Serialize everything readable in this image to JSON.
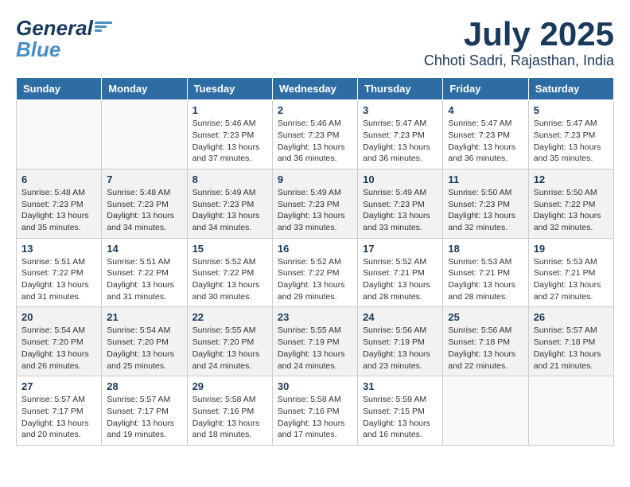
{
  "header": {
    "logo_general": "General",
    "logo_blue": "Blue",
    "month_title": "July 2025",
    "location": "Chhoti Sadri, Rajasthan, India"
  },
  "days_of_week": [
    "Sunday",
    "Monday",
    "Tuesday",
    "Wednesday",
    "Thursday",
    "Friday",
    "Saturday"
  ],
  "weeks": [
    [
      {
        "day": "",
        "info": ""
      },
      {
        "day": "",
        "info": ""
      },
      {
        "day": "1",
        "info": "Sunrise: 5:46 AM\nSunset: 7:23 PM\nDaylight: 13 hours and 37 minutes."
      },
      {
        "day": "2",
        "info": "Sunrise: 5:46 AM\nSunset: 7:23 PM\nDaylight: 13 hours and 36 minutes."
      },
      {
        "day": "3",
        "info": "Sunrise: 5:47 AM\nSunset: 7:23 PM\nDaylight: 13 hours and 36 minutes."
      },
      {
        "day": "4",
        "info": "Sunrise: 5:47 AM\nSunset: 7:23 PM\nDaylight: 13 hours and 36 minutes."
      },
      {
        "day": "5",
        "info": "Sunrise: 5:47 AM\nSunset: 7:23 PM\nDaylight: 13 hours and 35 minutes."
      }
    ],
    [
      {
        "day": "6",
        "info": "Sunrise: 5:48 AM\nSunset: 7:23 PM\nDaylight: 13 hours and 35 minutes."
      },
      {
        "day": "7",
        "info": "Sunrise: 5:48 AM\nSunset: 7:23 PM\nDaylight: 13 hours and 34 minutes."
      },
      {
        "day": "8",
        "info": "Sunrise: 5:49 AM\nSunset: 7:23 PM\nDaylight: 13 hours and 34 minutes."
      },
      {
        "day": "9",
        "info": "Sunrise: 5:49 AM\nSunset: 7:23 PM\nDaylight: 13 hours and 33 minutes."
      },
      {
        "day": "10",
        "info": "Sunrise: 5:49 AM\nSunset: 7:23 PM\nDaylight: 13 hours and 33 minutes."
      },
      {
        "day": "11",
        "info": "Sunrise: 5:50 AM\nSunset: 7:23 PM\nDaylight: 13 hours and 32 minutes."
      },
      {
        "day": "12",
        "info": "Sunrise: 5:50 AM\nSunset: 7:22 PM\nDaylight: 13 hours and 32 minutes."
      }
    ],
    [
      {
        "day": "13",
        "info": "Sunrise: 5:51 AM\nSunset: 7:22 PM\nDaylight: 13 hours and 31 minutes."
      },
      {
        "day": "14",
        "info": "Sunrise: 5:51 AM\nSunset: 7:22 PM\nDaylight: 13 hours and 31 minutes."
      },
      {
        "day": "15",
        "info": "Sunrise: 5:52 AM\nSunset: 7:22 PM\nDaylight: 13 hours and 30 minutes."
      },
      {
        "day": "16",
        "info": "Sunrise: 5:52 AM\nSunset: 7:22 PM\nDaylight: 13 hours and 29 minutes."
      },
      {
        "day": "17",
        "info": "Sunrise: 5:52 AM\nSunset: 7:21 PM\nDaylight: 13 hours and 28 minutes."
      },
      {
        "day": "18",
        "info": "Sunrise: 5:53 AM\nSunset: 7:21 PM\nDaylight: 13 hours and 28 minutes."
      },
      {
        "day": "19",
        "info": "Sunrise: 5:53 AM\nSunset: 7:21 PM\nDaylight: 13 hours and 27 minutes."
      }
    ],
    [
      {
        "day": "20",
        "info": "Sunrise: 5:54 AM\nSunset: 7:20 PM\nDaylight: 13 hours and 26 minutes."
      },
      {
        "day": "21",
        "info": "Sunrise: 5:54 AM\nSunset: 7:20 PM\nDaylight: 13 hours and 25 minutes."
      },
      {
        "day": "22",
        "info": "Sunrise: 5:55 AM\nSunset: 7:20 PM\nDaylight: 13 hours and 24 minutes."
      },
      {
        "day": "23",
        "info": "Sunrise: 5:55 AM\nSunset: 7:19 PM\nDaylight: 13 hours and 24 minutes."
      },
      {
        "day": "24",
        "info": "Sunrise: 5:56 AM\nSunset: 7:19 PM\nDaylight: 13 hours and 23 minutes."
      },
      {
        "day": "25",
        "info": "Sunrise: 5:56 AM\nSunset: 7:18 PM\nDaylight: 13 hours and 22 minutes."
      },
      {
        "day": "26",
        "info": "Sunrise: 5:57 AM\nSunset: 7:18 PM\nDaylight: 13 hours and 21 minutes."
      }
    ],
    [
      {
        "day": "27",
        "info": "Sunrise: 5:57 AM\nSunset: 7:17 PM\nDaylight: 13 hours and 20 minutes."
      },
      {
        "day": "28",
        "info": "Sunrise: 5:57 AM\nSunset: 7:17 PM\nDaylight: 13 hours and 19 minutes."
      },
      {
        "day": "29",
        "info": "Sunrise: 5:58 AM\nSunset: 7:16 PM\nDaylight: 13 hours and 18 minutes."
      },
      {
        "day": "30",
        "info": "Sunrise: 5:58 AM\nSunset: 7:16 PM\nDaylight: 13 hours and 17 minutes."
      },
      {
        "day": "31",
        "info": "Sunrise: 5:59 AM\nSunset: 7:15 PM\nDaylight: 13 hours and 16 minutes."
      },
      {
        "day": "",
        "info": ""
      },
      {
        "day": "",
        "info": ""
      }
    ]
  ]
}
